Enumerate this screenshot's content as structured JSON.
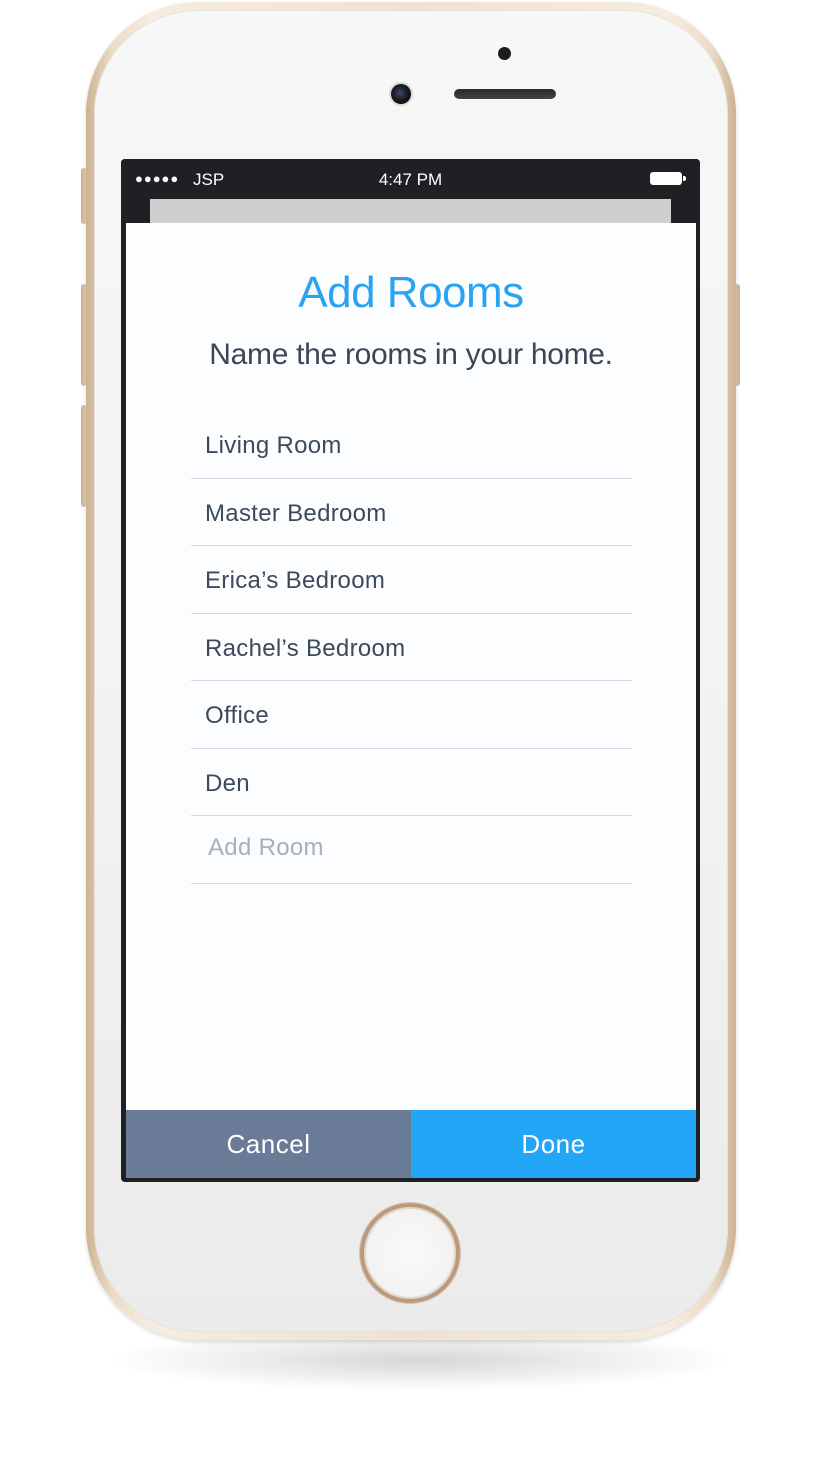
{
  "status_bar": {
    "signal": "●●●●●",
    "carrier": "JSP",
    "time": "4:47 PM"
  },
  "screen": {
    "title": "Add Rooms",
    "subtitle": "Name the rooms in your home.",
    "rooms": [
      {
        "label": "Living Room"
      },
      {
        "label": "Master Bedroom"
      },
      {
        "label": "Erica’s Bedroom"
      },
      {
        "label": "Rachel’s Bedroom"
      },
      {
        "label": "Office"
      },
      {
        "label": "Den"
      }
    ],
    "add_room": {
      "placeholder": "Add Room",
      "value": ""
    }
  },
  "footer": {
    "cancel_label": "Cancel",
    "done_label": "Done"
  },
  "colors": {
    "accent": "#2aa3f2",
    "done_button": "#24a6f6",
    "cancel_button": "#6a7b98",
    "text": "#3c4a5a"
  }
}
